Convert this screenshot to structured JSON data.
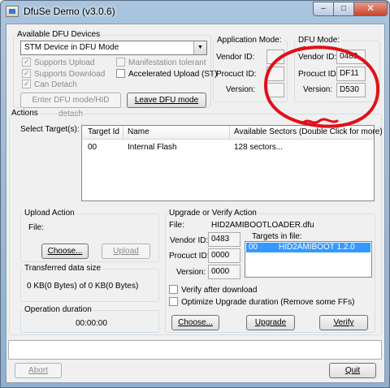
{
  "window": {
    "title": "DfuSe Demo (v3.0.6)"
  },
  "caption": {
    "minimize": "–",
    "maximize": "□",
    "close": "✕"
  },
  "available_devices": {
    "legend": "Available DFU Devices",
    "selected_device": "STM Device in DFU Mode",
    "options": {
      "supports_upload": {
        "label": "Supports Upload",
        "checked": true
      },
      "supports_download": {
        "label": "Supports Download",
        "checked": true
      },
      "can_detach": {
        "label": "Can Detach",
        "checked": true
      },
      "manifestation_tolerant": {
        "label": "Manifestation tolerant",
        "checked": false
      },
      "accelerated_upload": {
        "label": "Accelerated Upload (ST)",
        "checked": false
      }
    },
    "enter_dfu_label": "Enter DFU mode/HID detach",
    "leave_dfu_label": "Leave DFU mode"
  },
  "application_mode": {
    "legend": "Application Mode:",
    "vendor_id_label": "Vendor ID:",
    "product_id_label": "Procuct ID:",
    "version_label": "Version:",
    "vendor_id": "",
    "product_id": "",
    "version": ""
  },
  "dfu_mode": {
    "legend": "DFU Mode:",
    "vendor_id_label": "Vendor ID:",
    "product_id_label": "Procuct ID:",
    "version_label": "Version:",
    "vendor_id": "0483",
    "product_id": "DF11",
    "version": "D530"
  },
  "actions": {
    "legend": "Actions",
    "select_targets_label": "Select Target(s):",
    "columns": [
      "Target Id",
      "Name",
      "Available Sectors (Double Click for more)"
    ],
    "rows": [
      {
        "target_id": "00",
        "name": "Internal Flash",
        "sectors": "128 sectors..."
      }
    ]
  },
  "upload": {
    "legend": "Upload Action",
    "file_label": "File:",
    "choose_label": "Choose...",
    "upload_label": "Upload"
  },
  "transferred": {
    "legend": "Transferred data size",
    "value": "0 KB(0 Bytes) of 0 KB(0 Bytes)"
  },
  "duration": {
    "legend": "Operation duration",
    "value": "00:00:00"
  },
  "upgrade": {
    "legend": "Upgrade or Verify Action",
    "file_label": "File:",
    "file_name": "HID2AMIBOOTLOADER.dfu",
    "vendor_id_label": "Vendor ID:",
    "product_id_label": "Procuct ID:",
    "version_label": "Version:",
    "vendor_id": "0483",
    "product_id": "0000",
    "version": "0000",
    "targets_label": "Targets in file:",
    "targets": [
      {
        "id": "00",
        "name": "HID2AMIBOOT  1.2.0"
      }
    ],
    "verify_after_download": {
      "label": "Verify after download",
      "checked": false
    },
    "optimize": {
      "label": "Optimize Upgrade duration (Remove some FFs)",
      "checked": false
    },
    "choose_label": "Choose...",
    "upgrade_label": "Upgrade",
    "verify_label": "Verify"
  },
  "status": {
    "text": ""
  },
  "footer": {
    "abort_label": "Abort",
    "quit_label": "Quit"
  },
  "annotation": {
    "color": "#e0101a"
  }
}
